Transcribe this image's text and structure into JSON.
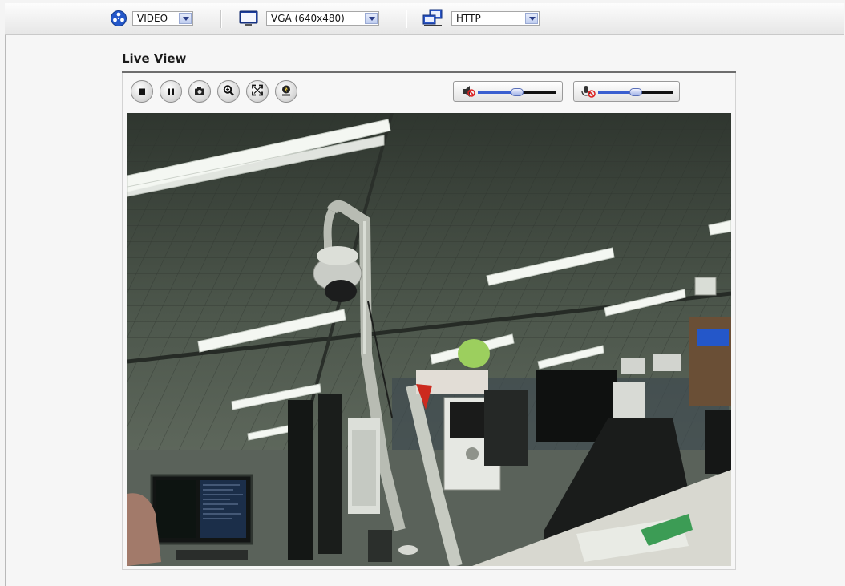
{
  "toolbar": {
    "stream_icon": "film-reel-icon",
    "stream_select": "VIDEO",
    "resolution_icon": "monitor-icon",
    "resolution_select": "VGA (640x480)",
    "protocol_icon": "network-computers-icon",
    "protocol_select": "HTTP"
  },
  "live_view": {
    "title": "Live View",
    "controls": [
      {
        "name": "stop-button",
        "icon": "stop-icon"
      },
      {
        "name": "pause-button",
        "icon": "pause-icon"
      },
      {
        "name": "snapshot-button",
        "icon": "camera-icon"
      },
      {
        "name": "zoom-button",
        "icon": "magnifier-icon"
      },
      {
        "name": "fullscreen-button",
        "icon": "fullscreen-icon"
      },
      {
        "name": "record-button",
        "icon": "record-icon"
      }
    ],
    "speaker_volume": {
      "icon": "speaker-muted-icon",
      "level": 0.5
    },
    "mic_volume": {
      "icon": "microphone-muted-icon",
      "level": 0.5
    }
  },
  "colors": {
    "accent": "#2c3f88",
    "slider_fill": "#3a5fd0"
  }
}
